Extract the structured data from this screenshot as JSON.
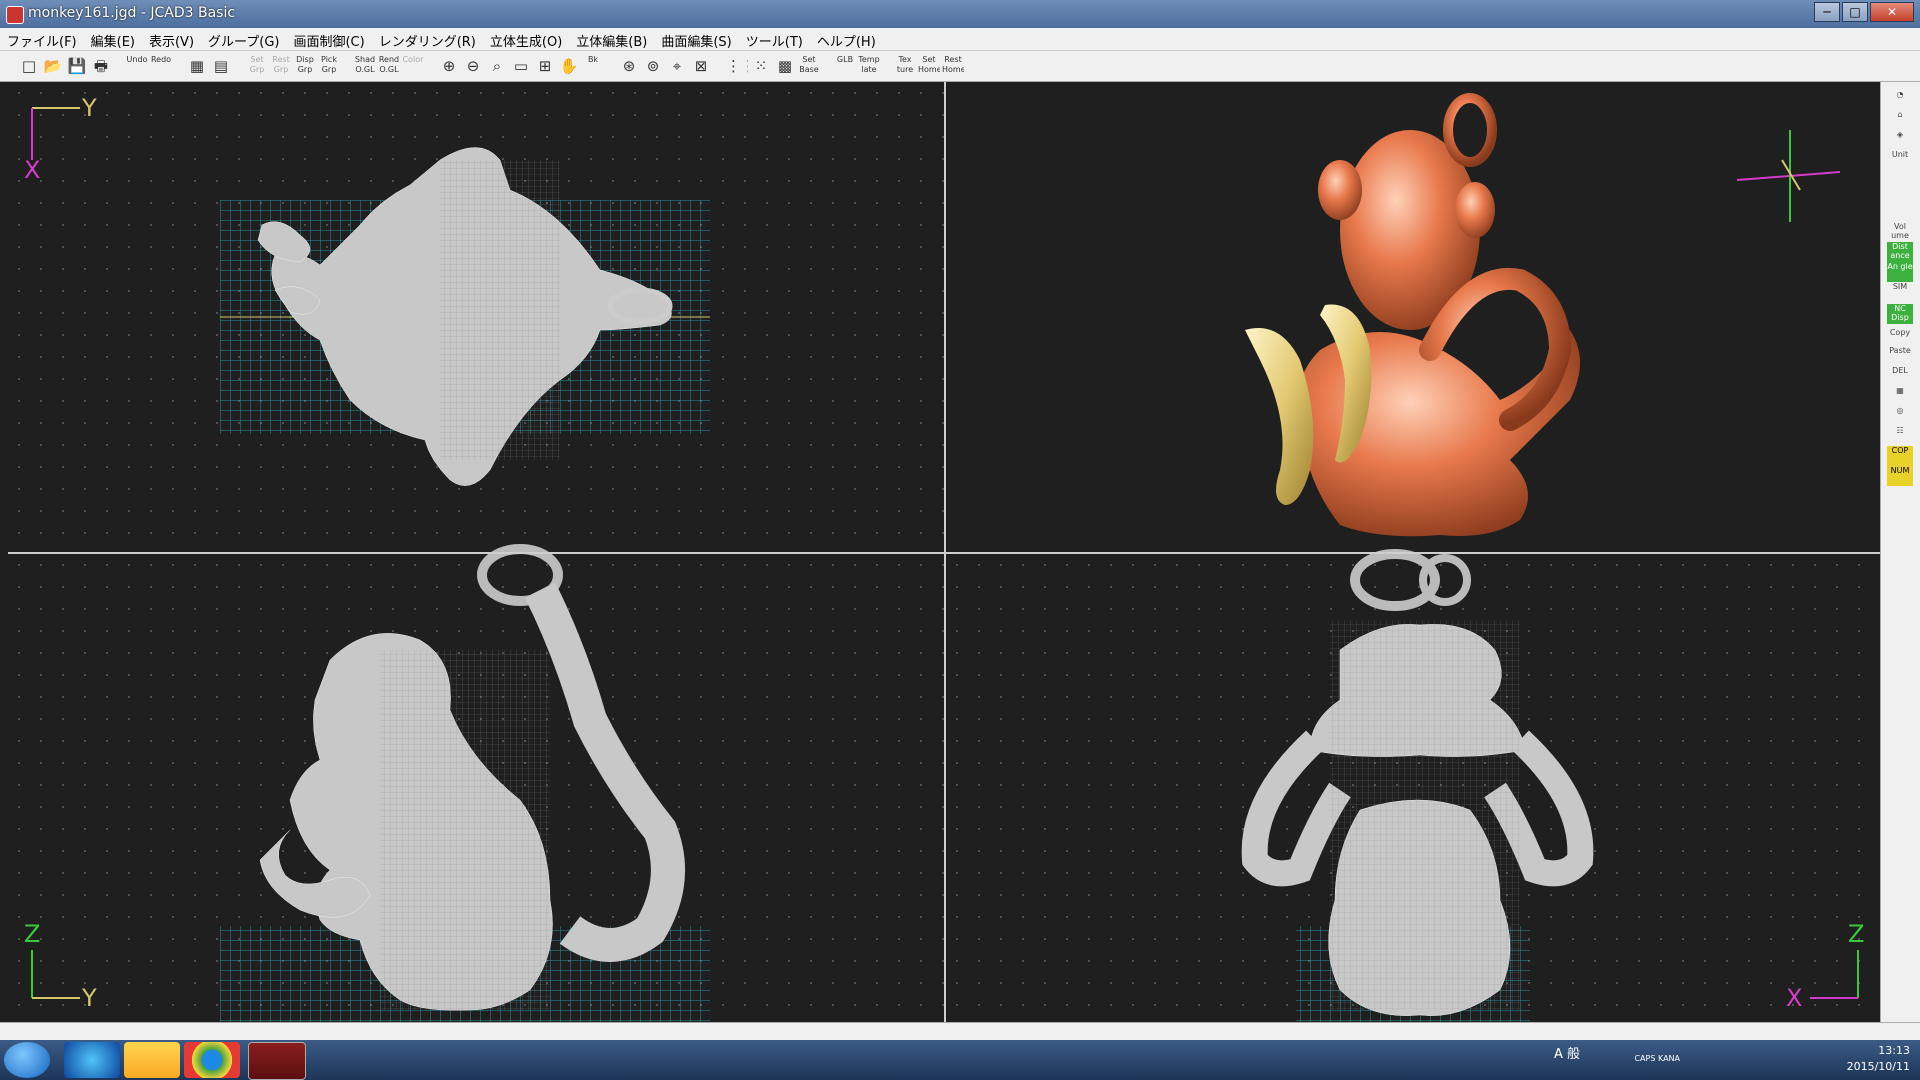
{
  "window": {
    "title": "monkey161.jgd - JCAD3 Basic",
    "buttons": [
      "─",
      "□",
      "✕"
    ]
  },
  "menu": [
    "ファイル(F)",
    "編集(E)",
    "表示(V)",
    "グループ(G)",
    "画面制御(C)",
    "レンダリング(R)",
    "立体生成(O)",
    "立体編集(B)",
    "曲面編集(S)",
    "ツール(T)",
    "ヘルプ(H)"
  ],
  "toolbar": [
    {
      "label": "□",
      "glyph": true
    },
    {
      "label": "📂",
      "glyph": true
    },
    {
      "label": "💾",
      "glyph": true
    },
    {
      "label": "🖶",
      "glyph": true
    },
    {
      "label": "Undo"
    },
    {
      "label": "Redo"
    },
    {
      "label": "▦",
      "glyph": true
    },
    {
      "label": "▤",
      "glyph": true
    },
    {
      "label": "Set Grp",
      "dim": true
    },
    {
      "label": "Rest Grp",
      "dim": true
    },
    {
      "label": "Disp Grp"
    },
    {
      "label": "Pick Grp"
    },
    {
      "label": "Shad O.GL"
    },
    {
      "label": "Rend O.GL"
    },
    {
      "label": "Color",
      "dim": true
    },
    {
      "label": "⊕",
      "glyph": true
    },
    {
      "label": "⊖",
      "glyph": true
    },
    {
      "label": "⌕",
      "glyph": true
    },
    {
      "label": "▭",
      "glyph": true
    },
    {
      "label": "⊞",
      "glyph": true
    },
    {
      "label": "✋",
      "glyph": true
    },
    {
      "label": "Bk"
    },
    {
      "label": "⊛",
      "glyph": true
    },
    {
      "label": "⊚",
      "glyph": true
    },
    {
      "label": "⌖",
      "glyph": true
    },
    {
      "label": "⊠",
      "glyph": true
    },
    {
      "label": "⋮⋮",
      "glyph": true
    },
    {
      "label": "⁙",
      "glyph": true
    },
    {
      "label": "▩",
      "glyph": true
    },
    {
      "label": "Set Base"
    },
    {
      "label": "GLB"
    },
    {
      "label": "Temp late"
    },
    {
      "label": "Tex ture"
    },
    {
      "label": "Set Home"
    },
    {
      "label": "Rest Home"
    }
  ],
  "rightbar": [
    {
      "label": "◔"
    },
    {
      "label": "⌂"
    },
    {
      "label": "◈"
    },
    {
      "label": "Unit"
    },
    {
      "label": "Vol ume"
    },
    {
      "label": "Dist ance",
      "style": "green"
    },
    {
      "label": "An gle",
      "style": "green"
    },
    {
      "label": "SIM"
    },
    {
      "label": "NC Disp",
      "style": "green"
    },
    {
      "label": "Copy"
    },
    {
      "label": "Paste"
    },
    {
      "label": "DEL"
    },
    {
      "label": "▦"
    },
    {
      "label": "◎"
    },
    {
      "label": "☷"
    },
    {
      "label": "COP",
      "style": "yellow"
    },
    {
      "label": "NUM",
      "style": "yellow"
    }
  ],
  "views": {
    "top": {
      "axes": [
        "Y",
        "X"
      ]
    },
    "side": {
      "axes": [
        "Z",
        "Y"
      ]
    },
    "front": {
      "axes": [
        "Z",
        "X"
      ]
    }
  },
  "taskbar": {
    "time": "13:13",
    "date": "2015/10/11",
    "ime": "A 般",
    "caps": "CAPS KANA"
  },
  "colors": {
    "grid": "#2aa5b6",
    "mesh": "#c8c8c8",
    "monkey": "#e07a4f",
    "banana": "#e6d27a",
    "axis_x": "#d23cc8",
    "axis_y": "#d7c76a",
    "axis_z": "#3cc83c"
  }
}
